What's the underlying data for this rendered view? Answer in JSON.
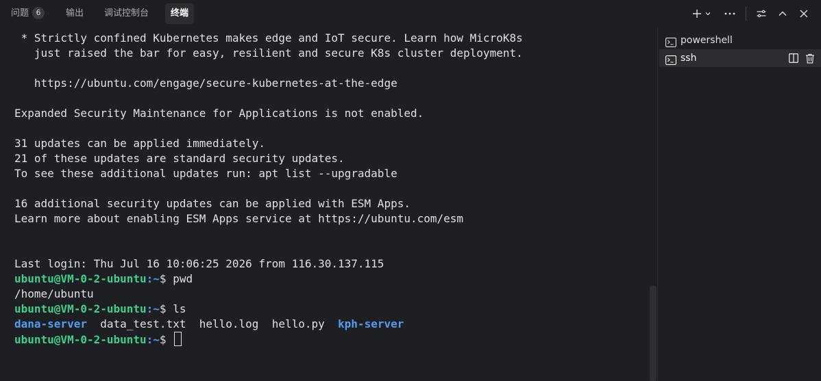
{
  "tabs": [
    {
      "label": "问题",
      "badge": "6"
    },
    {
      "label": "输出"
    },
    {
      "label": "调试控制台"
    },
    {
      "label": "终端",
      "active": true
    }
  ],
  "toolbar": {
    "icons": [
      "plus-icon",
      "chevron-down-icon",
      "more-icon",
      "sliders-icon",
      "chevron-up-icon",
      "close-icon"
    ]
  },
  "terminal": {
    "lines": [
      " * Strictly confined Kubernetes makes edge and IoT secure. Learn how MicroK8s",
      "   just raised the bar for easy, resilient and secure K8s cluster deployment.",
      "",
      "   https://ubuntu.com/engage/secure-kubernetes-at-the-edge",
      "",
      "Expanded Security Maintenance for Applications is not enabled.",
      "",
      "31 updates can be applied immediately.",
      "21 of these updates are standard security updates.",
      "To see these additional updates run: apt list --upgradable",
      "",
      "16 additional security updates can be applied with ESM Apps.",
      "Learn more about enabling ESM Apps service at https://ubuntu.com/esm",
      "",
      "",
      "Last login: Thu Jul 16 10:06:25 2026 from 116.30.137.115"
    ],
    "prompt_user": "ubuntu@VM-0-2-ubuntu",
    "prompt_path": ":~",
    "prompt_sign": "$ ",
    "cmd1": "pwd",
    "output1": "/home/ubuntu",
    "cmd2": "ls",
    "ls_items": [
      "dana-server",
      "data_test.txt",
      "hello.log",
      "hello.py",
      "kph-server"
    ],
    "ls_gap": "  "
  },
  "sessions": [
    {
      "label": "powershell",
      "icon": "terminal-icon"
    },
    {
      "label": "ssh",
      "icon": "terminal-icon",
      "active": true
    }
  ],
  "colors": {
    "background": "#1e1f22",
    "prompt_user": "#3ecf8e",
    "prompt_path": "#4f9df0",
    "directory": "#4f9df0",
    "text": "#dfe1e5"
  }
}
